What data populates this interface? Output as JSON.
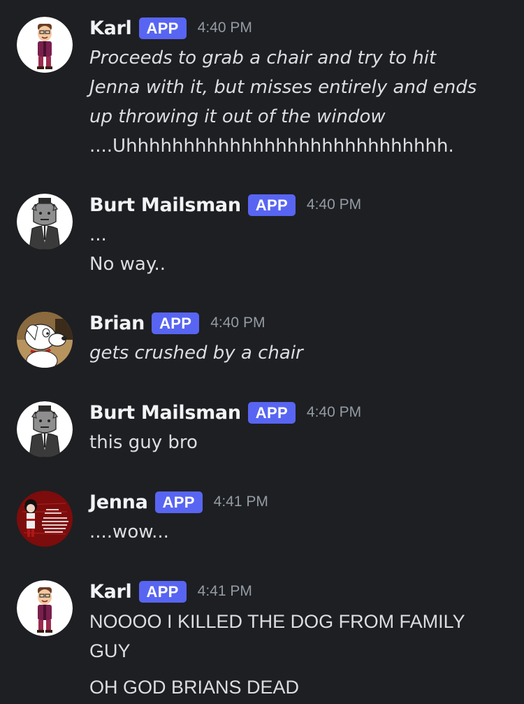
{
  "badge_label": "APP",
  "messages": [
    {
      "author": "Karl",
      "time": "4:40 PM",
      "avatar": "karl-avatar",
      "lines": [
        "Proceeds to grab a chair and try to hit",
        "Jenna with it, but misses entirely and ends",
        "up throwing it out of the window",
        "....Uhhhhhhhhhhhhhhhhhhhhhhhhhhhh."
      ]
    },
    {
      "author": "Burt Mailsman",
      "time": "4:40 PM",
      "avatar": "burt-avatar",
      "lines": [
        "...",
        "No way.."
      ]
    },
    {
      "author": "Brian",
      "time": "4:40 PM",
      "avatar": "brian-avatar",
      "lines": [
        "gets crushed by a chair"
      ]
    },
    {
      "author": "Burt Mailsman",
      "time": "4:40 PM",
      "avatar": "burt-avatar",
      "lines": [
        "this guy bro"
      ]
    },
    {
      "author": "Jenna",
      "time": "4:41 PM",
      "avatar": "jenna-avatar",
      "lines": [
        "....wow..."
      ]
    },
    {
      "author": "Karl",
      "time": "4:41 PM",
      "avatar": "karl-avatar",
      "lines": [
        "NOOOO I KILLED THE DOG FROM FAMILY",
        "GUY",
        "OH GOD BRIANS DEAD"
      ]
    }
  ],
  "colors": {
    "background": "#1e1f22",
    "badge": "#5865f2",
    "username": "#f2f3f5",
    "timestamp": "#949ba4",
    "text": "#dbdee1"
  }
}
